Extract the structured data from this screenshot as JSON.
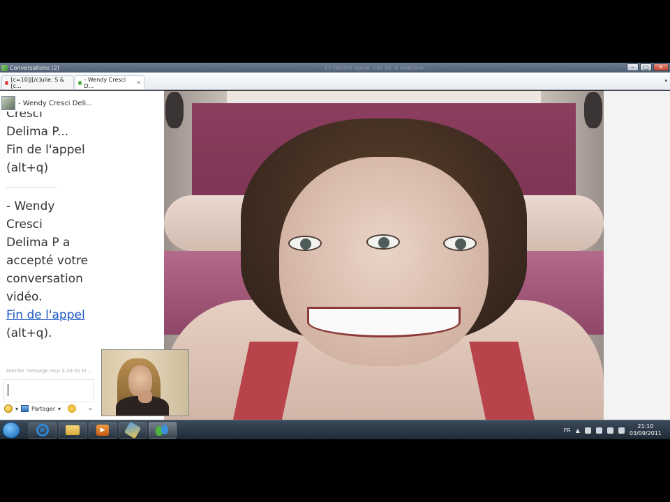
{
  "window": {
    "title": "Conversations (2)",
    "ghost_title": "En faisant appel, cile de la webcam..."
  },
  "window_controls": {
    "minimize": "–",
    "maximize": "□",
    "close": "✕"
  },
  "tabs": [
    {
      "label": "[c=10]J[/c]ulie. S & [c...",
      "status_color": "#e04040",
      "close": "✕"
    },
    {
      "label": "- Wendy Cresci D...",
      "status_color": "#4cae3c",
      "close": "✕"
    }
  ],
  "tab_menu_arrow": "▾",
  "contact": {
    "name": "- Wendy Cresci Deli..."
  },
  "messages": {
    "block1": [
      "Cresci",
      "Delima P...",
      "Fin de l'appel",
      "(alt+q)"
    ],
    "block2": [
      "- Wendy",
      "Cresci",
      "Delima P a",
      "accepté votre",
      "conversation",
      "vidéo."
    ],
    "link": "Fin de l'appel",
    "link_suffix": "(alt+q)."
  },
  "last_message": "Dernier message reçu à 20:01 le ...",
  "chat_toolbar": {
    "emoji_arrow": "▾",
    "share_label": "Partager",
    "share_arrow": "▾",
    "more": "»"
  },
  "taskbar": {
    "language": "FR",
    "tray_arrow": "▲",
    "time": "21:10",
    "date": "03/09/2011"
  },
  "icons": {
    "ie": "e",
    "media": "▶"
  }
}
